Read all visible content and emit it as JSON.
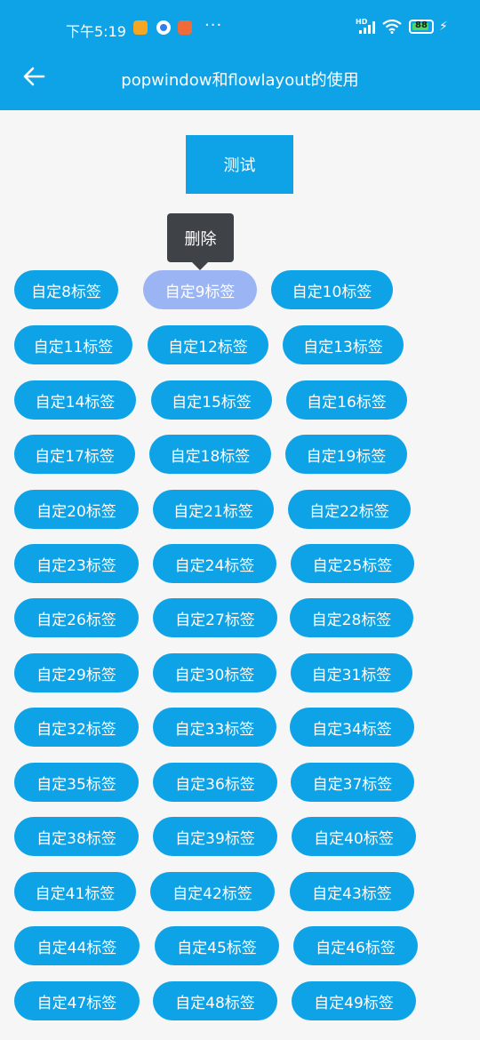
{
  "status_bar": {
    "time": "下午5:19",
    "battery_level": "88",
    "network": "HD"
  },
  "header": {
    "title": "popwindow和flowlayout的使用"
  },
  "test_button": {
    "label": "测试"
  },
  "popup": {
    "delete_label": "删除"
  },
  "tags": [
    {
      "label": "自定8标签"
    },
    {
      "label": "自定9标签",
      "selected": true
    },
    {
      "label": "自定10标签"
    },
    {
      "label": "自定11标签"
    },
    {
      "label": "自定12标签"
    },
    {
      "label": "自定13标签"
    },
    {
      "label": "自定14标签"
    },
    {
      "label": "自定15标签"
    },
    {
      "label": "自定16标签"
    },
    {
      "label": "自定17标签"
    },
    {
      "label": "自定18标签"
    },
    {
      "label": "自定19标签"
    },
    {
      "label": "自定20标签"
    },
    {
      "label": "自定21标签"
    },
    {
      "label": "自定22标签"
    },
    {
      "label": "自定23标签"
    },
    {
      "label": "自定24标签"
    },
    {
      "label": "自定25标签"
    },
    {
      "label": "自定26标签"
    },
    {
      "label": "自定27标签"
    },
    {
      "label": "自定28标签"
    },
    {
      "label": "自定29标签"
    },
    {
      "label": "自定30标签"
    },
    {
      "label": "自定31标签"
    },
    {
      "label": "自定32标签"
    },
    {
      "label": "自定33标签"
    },
    {
      "label": "自定34标签"
    },
    {
      "label": "自定35标签"
    },
    {
      "label": "自定36标签"
    },
    {
      "label": "自定37标签"
    },
    {
      "label": "自定38标签"
    },
    {
      "label": "自定39标签"
    },
    {
      "label": "自定40标签"
    },
    {
      "label": "自定41标签"
    },
    {
      "label": "自定42标签"
    },
    {
      "label": "自定43标签"
    },
    {
      "label": "自定44标签"
    },
    {
      "label": "自定45标签"
    },
    {
      "label": "自定46标签"
    },
    {
      "label": "自定47标签"
    },
    {
      "label": "自定48标签"
    },
    {
      "label": "自定49标签"
    }
  ],
  "colors": {
    "primary": "#0ea3e6",
    "selected_tag": "#9bb4f4",
    "popup_bg": "#3f4347",
    "background": "#f6f6f6"
  }
}
